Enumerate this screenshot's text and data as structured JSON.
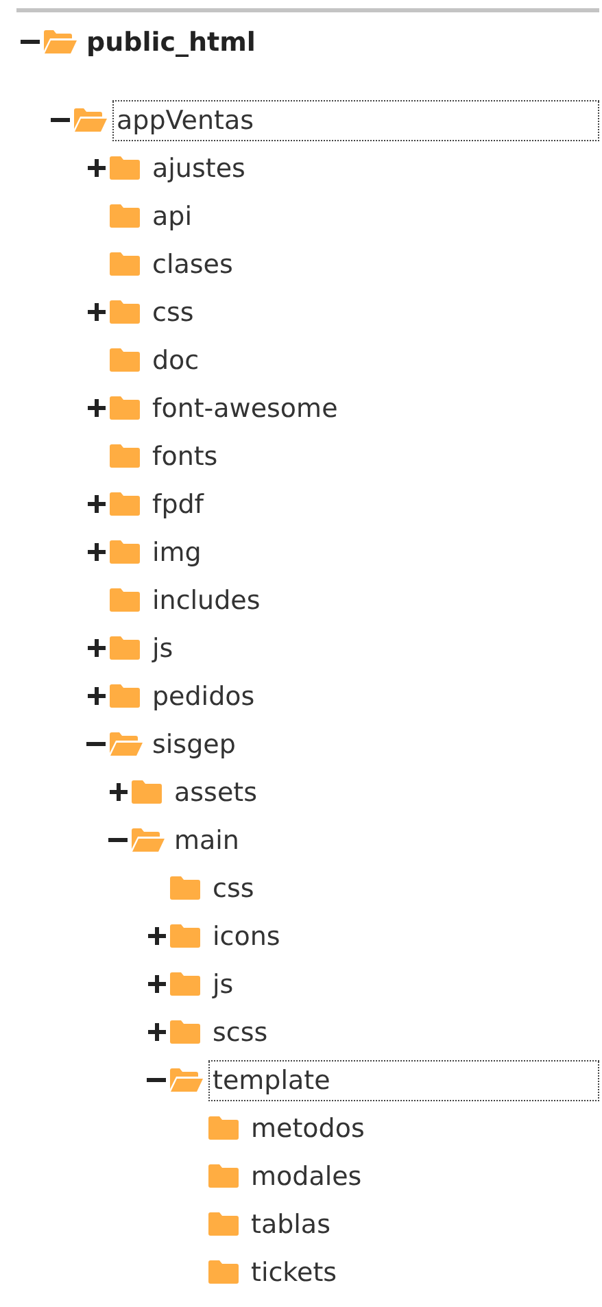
{
  "tree": [
    {
      "name": "public_html",
      "kind": "open",
      "selected": false,
      "children": [
        {
          "name": "appVentas",
          "kind": "open",
          "selected": true,
          "children": [
            {
              "name": "ajustes",
              "kind": "closed",
              "selected": false
            },
            {
              "name": "api",
              "kind": "leaf",
              "selected": false
            },
            {
              "name": "clases",
              "kind": "leaf",
              "selected": false
            },
            {
              "name": "css",
              "kind": "closed",
              "selected": false
            },
            {
              "name": "doc",
              "kind": "leaf",
              "selected": false
            },
            {
              "name": "font-awesome",
              "kind": "closed",
              "selected": false
            },
            {
              "name": "fonts",
              "kind": "leaf",
              "selected": false
            },
            {
              "name": "fpdf",
              "kind": "closed",
              "selected": false
            },
            {
              "name": "img",
              "kind": "closed",
              "selected": false
            },
            {
              "name": "includes",
              "kind": "leaf",
              "selected": false
            },
            {
              "name": "js",
              "kind": "closed",
              "selected": false
            },
            {
              "name": "pedidos",
              "kind": "closed",
              "selected": false
            },
            {
              "name": "sisgep",
              "kind": "open",
              "selected": false,
              "children": [
                {
                  "name": "assets",
                  "kind": "closed",
                  "selected": false
                },
                {
                  "name": "main",
                  "kind": "open",
                  "selected": false,
                  "children": [
                    {
                      "name": "css",
                      "kind": "leaf",
                      "selected": false
                    },
                    {
                      "name": "icons",
                      "kind": "closed",
                      "selected": false
                    },
                    {
                      "name": "js",
                      "kind": "closed",
                      "selected": false
                    },
                    {
                      "name": "scss",
                      "kind": "closed",
                      "selected": false
                    },
                    {
                      "name": "template",
                      "kind": "open",
                      "selected": true,
                      "children": [
                        {
                          "name": "metodos",
                          "kind": "leaf",
                          "selected": false
                        },
                        {
                          "name": "modales",
                          "kind": "leaf",
                          "selected": false
                        },
                        {
                          "name": "tablas",
                          "kind": "leaf",
                          "selected": false
                        },
                        {
                          "name": "tickets",
                          "kind": "leaf",
                          "selected": false
                        }
                      ]
                    }
                  ]
                }
              ]
            }
          ]
        }
      ]
    }
  ]
}
